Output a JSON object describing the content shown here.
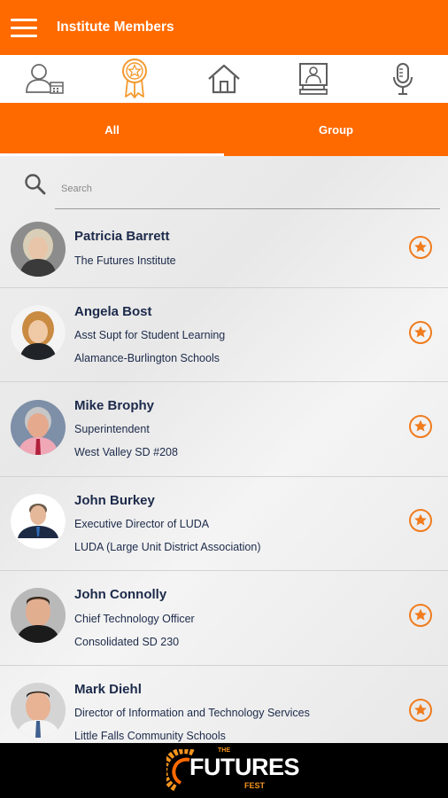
{
  "app": {
    "title": "Institute Members"
  },
  "iconbar": {
    "items": [
      {
        "icon": "directory-icon"
      },
      {
        "icon": "award-ribbon-icon"
      },
      {
        "icon": "home-icon"
      },
      {
        "icon": "presentation-icon"
      },
      {
        "icon": "microphone-icon"
      }
    ],
    "active_index": 1
  },
  "tabs": [
    {
      "label": "All",
      "active": true
    },
    {
      "label": "Group",
      "active": false
    }
  ],
  "search": {
    "placeholder": "Search",
    "value": ""
  },
  "members": [
    {
      "name": "Patricia Barrett",
      "line1": "The Futures Institute",
      "line2": ""
    },
    {
      "name": "Angela Bost",
      "line1": "Asst Supt for Student Learning",
      "line2": "Alamance-Burlington Schools"
    },
    {
      "name": "Mike Brophy",
      "line1": "Superintendent",
      "line2": "West Valley SD #208"
    },
    {
      "name": "John Burkey",
      "line1": "Executive Director of LUDA",
      "line2": "LUDA (Large Unit District Association)"
    },
    {
      "name": "John Connolly",
      "line1": "Chief Technology Officer",
      "line2": "Consolidated SD 230"
    },
    {
      "name": "Mark Diehl",
      "line1": "Director of Information and Technology Services",
      "line2": "Little Falls Community Schools"
    }
  ],
  "footer": {
    "logo_the": "THE",
    "logo_main": "FUTURES",
    "logo_sub": "FEST"
  },
  "colors": {
    "accent": "#ff6a00",
    "star": "#f07c1e",
    "text_dark": "#1c2a4a",
    "footer_bg": "#000000"
  }
}
